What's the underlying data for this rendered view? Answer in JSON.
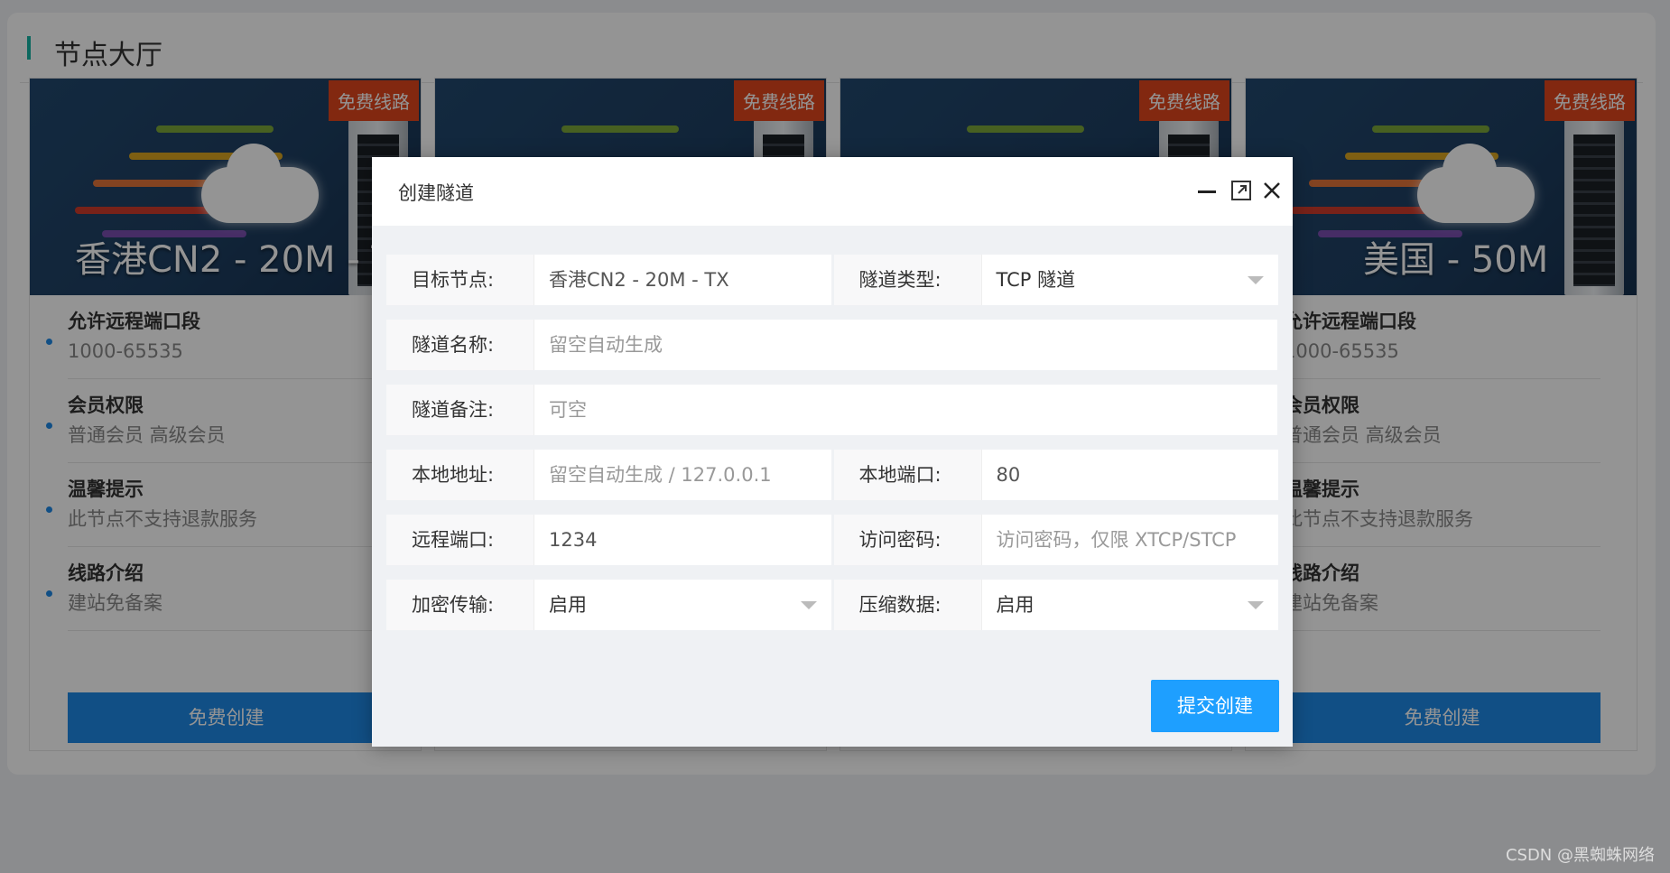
{
  "page": {
    "title": "节点大厅"
  },
  "nodes": [
    {
      "tag": "免费线路",
      "name": "香港CN2 - 20M - TX",
      "rows": [
        {
          "k": "允许远程端口段",
          "v": "1000-65535"
        },
        {
          "k": "会员权限",
          "v": "普通会员 高级会员"
        },
        {
          "k": "温馨提示",
          "v": "此节点不支持退款服务"
        },
        {
          "k": "线路介绍",
          "v": "建站免备案"
        }
      ],
      "button": "免费创建"
    },
    {
      "tag": "免费线路",
      "name": "",
      "rows": [],
      "button": ""
    },
    {
      "tag": "免费线路",
      "name": "",
      "rows": [],
      "button": ""
    },
    {
      "tag": "免费线路",
      "name": "美国 - 50M",
      "rows": [
        {
          "k": "允许远程端口段",
          "v": "1000-65535"
        },
        {
          "k": "会员权限",
          "v": "普通会员 高级会员"
        },
        {
          "k": "温馨提示",
          "v": "此节点不支持退款服务"
        },
        {
          "k": "线路介绍",
          "v": "建站免备案"
        }
      ],
      "button": "免费创建"
    }
  ],
  "modal": {
    "title": "创建隧道",
    "controls": {
      "minimize": "minimize-icon",
      "maximize": "maximize-icon",
      "close": "close-icon"
    },
    "fields": {
      "target_node": {
        "label": "目标节点:",
        "value": "香港CN2 - 20M - TX"
      },
      "tunnel_type": {
        "label": "隧道类型:",
        "value": "TCP 隧道"
      },
      "tunnel_name": {
        "label": "隧道名称:",
        "placeholder": "留空自动生成"
      },
      "tunnel_note": {
        "label": "隧道备注:",
        "placeholder": "可空"
      },
      "local_addr": {
        "label": "本地地址:",
        "placeholder": "留空自动生成 / 127.0.0.1"
      },
      "local_port": {
        "label": "本地端口:",
        "value": "80"
      },
      "remote_port": {
        "label": "远程端口:",
        "value": "1234"
      },
      "access_password": {
        "label": "访问密码:",
        "placeholder": "访问密码，仅限 XTCP/STCP"
      },
      "encryption": {
        "label": "加密传输:",
        "value": "启用"
      },
      "compression": {
        "label": "压缩数据:",
        "value": "启用"
      }
    },
    "submit": "提交创建"
  },
  "watermark": "CSDN @黑蜘蛛网络",
  "colors": {
    "accent": "#1e9fff",
    "card_button": "#1e88e5",
    "tag": "#e0461c",
    "title_bar": "#16b4a4"
  }
}
